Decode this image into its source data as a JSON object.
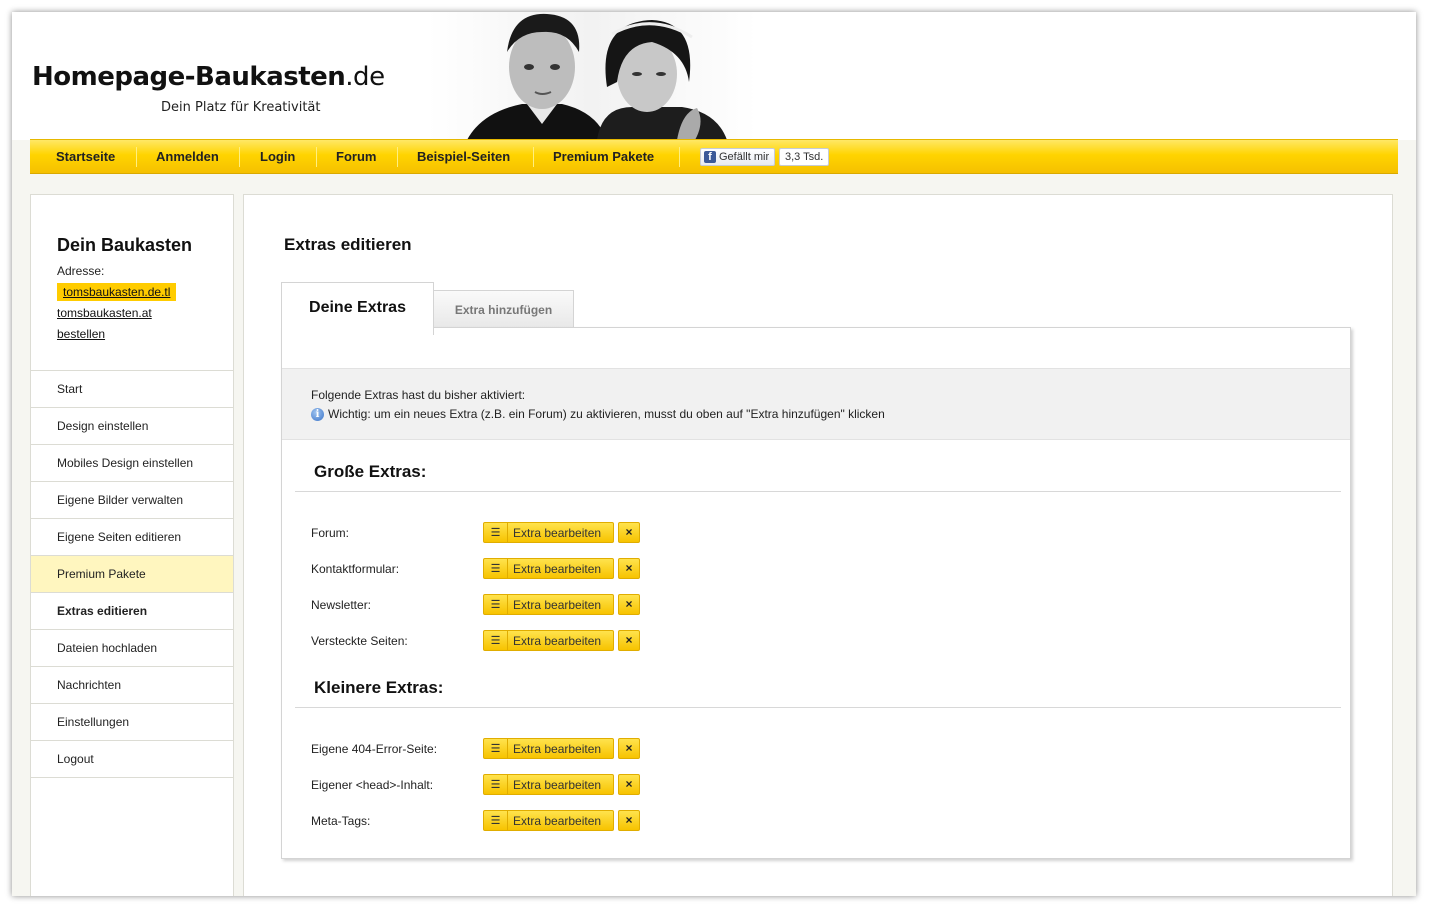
{
  "header": {
    "logo_main": "Homepage-Baukasten",
    "logo_tld": ".de",
    "tagline": "Dein Platz für Kreativität"
  },
  "nav": {
    "items": [
      "Startseite",
      "Anmelden",
      "Login",
      "Forum",
      "Beispiel-Seiten",
      "Premium Pakete"
    ],
    "fb_like_label": "Gefällt mir",
    "fb_count": "3,3 Tsd."
  },
  "sidebar": {
    "title": "Dein Baukasten",
    "address_label": "Adresse:",
    "address_main": "tomsbaukasten.de.tl",
    "address_alt": "tomsbaukasten.at",
    "order_label": "bestellen",
    "menu": [
      "Start",
      "Design einstellen",
      "Mobiles Design einstellen",
      "Eigene Bilder verwalten",
      "Eigene Seiten editieren",
      "Premium Pakete",
      "Extras editieren",
      "Dateien hochladen",
      "Nachrichten",
      "Einstellungen",
      "Logout"
    ]
  },
  "main": {
    "title": "Extras editieren",
    "tabs": [
      {
        "label": "Deine Extras",
        "active": true
      },
      {
        "label": "Extra hinzufügen",
        "active": false
      }
    ],
    "info_line1": "Folgende Extras hast du bisher aktiviert:",
    "info_line2": "Wichtig: um ein neues Extra (z.B. ein Forum) zu aktivieren, musst du oben auf \"Extra hinzufügen\" klicken",
    "edit_label": "Extra bearbeiten",
    "delete_symbol": "×",
    "sections": [
      {
        "title": "Große Extras:",
        "items": [
          "Forum:",
          "Kontaktformular:",
          "Newsletter:",
          "Versteckte Seiten:"
        ]
      },
      {
        "title": "Kleinere Extras:",
        "items": [
          "Eigene 404-Error-Seite:",
          "Eigener <head>-Inhalt:",
          "Meta-Tags:"
        ]
      }
    ]
  },
  "colors": {
    "accent": "#ffcc00",
    "nav_gradient_top": "#ffe866",
    "highlight_row": "#fff6bf"
  }
}
